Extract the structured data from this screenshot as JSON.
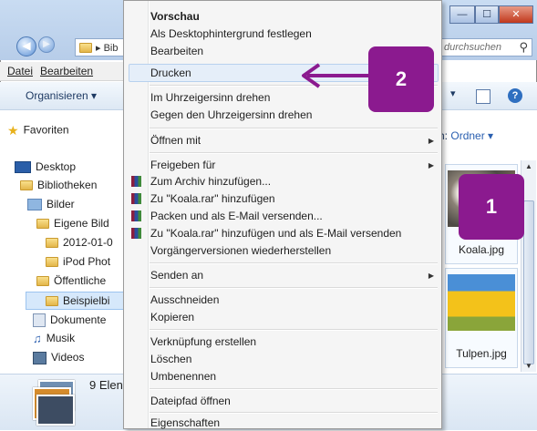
{
  "window": {
    "address_crumb": "Bib",
    "search_placeholder": "durchsuchen",
    "menubar": [
      "Datei",
      "Bearbeiten"
    ],
    "toolbar_organize": "Organisieren",
    "view_label": "h:",
    "view_value": "Ordner"
  },
  "nav": {
    "favorites": "Favoriten",
    "desktop": "Desktop",
    "libraries": "Bibliotheken",
    "pictures": "Bilder",
    "my_pictures": "Eigene Bild",
    "folder_2012": "2012-01-0",
    "ipod_photos": "iPod Phot",
    "public": "Öffentliche",
    "sample_pictures": "Beispielbi",
    "documents": "Dokumente",
    "music": "Musik",
    "videos": "Videos"
  },
  "files": [
    {
      "name": "Koala.jpg"
    },
    {
      "name": "Tulpen.jpg"
    }
  ],
  "status": {
    "count_text": "9 Elen"
  },
  "context_menu": {
    "preview": "Vorschau",
    "set_background": "Als Desktophintergrund festlegen",
    "edit": "Bearbeiten",
    "print": "Drucken",
    "rotate_cw": "Im Uhrzeigersinn drehen",
    "rotate_ccw": "Gegen den Uhrzeigersinn drehen",
    "open_with": "Öffnen mit",
    "share_with": "Freigeben für",
    "add_archive": "Zum Archiv hinzufügen...",
    "add_koala_rar": "Zu \"Koala.rar\" hinzufügen",
    "pack_email": "Packen und als E-Mail versenden...",
    "add_koala_rar_email": "Zu \"Koala.rar\" hinzufügen und als E-Mail versenden",
    "restore_versions": "Vorgängerversionen wiederherstellen",
    "send_to": "Senden an",
    "cut": "Ausschneiden",
    "copy": "Kopieren",
    "create_shortcut": "Verknüpfung erstellen",
    "delete": "Löschen",
    "rename": "Umbenennen",
    "open_path": "Dateipfad öffnen",
    "properties": "Eigenschaften"
  },
  "annotations": {
    "badge_1": "1",
    "badge_2": "2",
    "color": "#8b1a8f"
  },
  "colors": {
    "menu_bg": "#f5f5f5",
    "selection": "#d6e8fb"
  }
}
